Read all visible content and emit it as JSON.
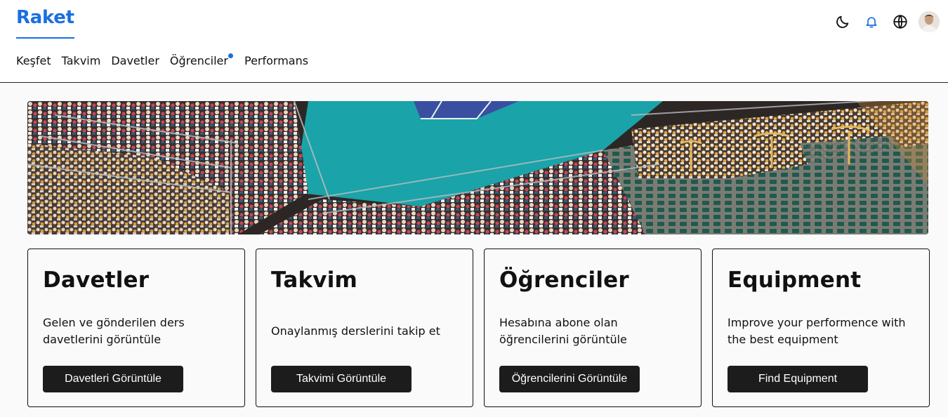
{
  "app": {
    "logo": "Raket"
  },
  "nav": {
    "items": [
      {
        "label": "Keşfet"
      },
      {
        "label": "Takvim"
      },
      {
        "label": "Davetler"
      },
      {
        "label": "Öğrenciler",
        "has_notification_dot": true
      },
      {
        "label": "Performans"
      }
    ]
  },
  "header_icons": [
    "moon-icon",
    "bell-icon",
    "globe-icon",
    "user-avatar"
  ],
  "colors": {
    "accent": "#1a6fe0",
    "button_bg": "#1c1c1c",
    "court": "#1aa3a8"
  },
  "cards": [
    {
      "title": "Davetler",
      "description": "Gelen ve gönderilen ders davetlerini görüntüle",
      "button": "Davetleri Görüntüle"
    },
    {
      "title": "Takvim",
      "description": "Onaylanmış derslerini takip et",
      "button": "Takvimi Görüntüle"
    },
    {
      "title": "Öğrenciler",
      "description": "Hesabına abone olan öğrencilerini görüntüle",
      "button": "Öğrencilerini Görüntüle"
    },
    {
      "title": "Equipment",
      "description": "Improve your performence with the best equipment",
      "button": "Find Equipment"
    }
  ]
}
